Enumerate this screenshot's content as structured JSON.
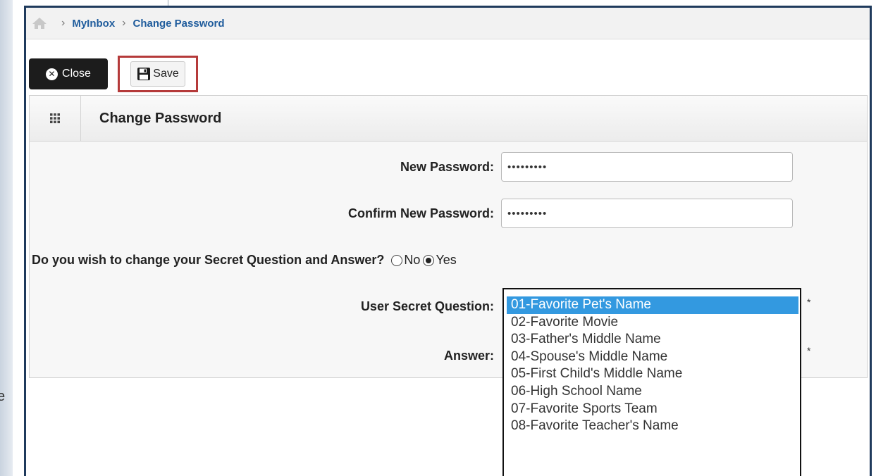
{
  "breadcrumb": {
    "items": [
      "MyInbox",
      "Change Password"
    ]
  },
  "toolbar": {
    "close_label": "Close",
    "save_label": "Save"
  },
  "panel": {
    "title": "Change Password"
  },
  "form": {
    "new_password": {
      "label": "New Password:",
      "value": "•••••••••"
    },
    "confirm_password": {
      "label": "Confirm New Password:",
      "value": "•••••••••"
    },
    "change_secret": {
      "label": "Do you wish to change your Secret Question and Answer?",
      "options": [
        {
          "label": "No",
          "checked": false
        },
        {
          "label": "Yes",
          "checked": true
        }
      ]
    },
    "secret_question": {
      "label": "User Secret Question:",
      "required_mark": "*",
      "options": [
        "01-Favorite Pet's Name",
        "02-Favorite Movie",
        "03-Father's Middle Name",
        "04-Spouse's Middle Name",
        "05-First Child's Middle Name",
        "06-High School Name",
        "07-Favorite Sports Team",
        "08-Favorite Teacher's Name"
      ],
      "selected_index": 0
    },
    "answer": {
      "label": "Answer:",
      "required_mark": "*"
    }
  },
  "outside": {
    "cut_letter": "e"
  },
  "colors": {
    "link": "#1f5c9c",
    "highlight_box": "#b53a3a",
    "selection": "#3399e0",
    "frame": "#1f3a5c"
  },
  "icons": [
    "home-icon",
    "close-icon",
    "save-icon",
    "grid-icon"
  ]
}
